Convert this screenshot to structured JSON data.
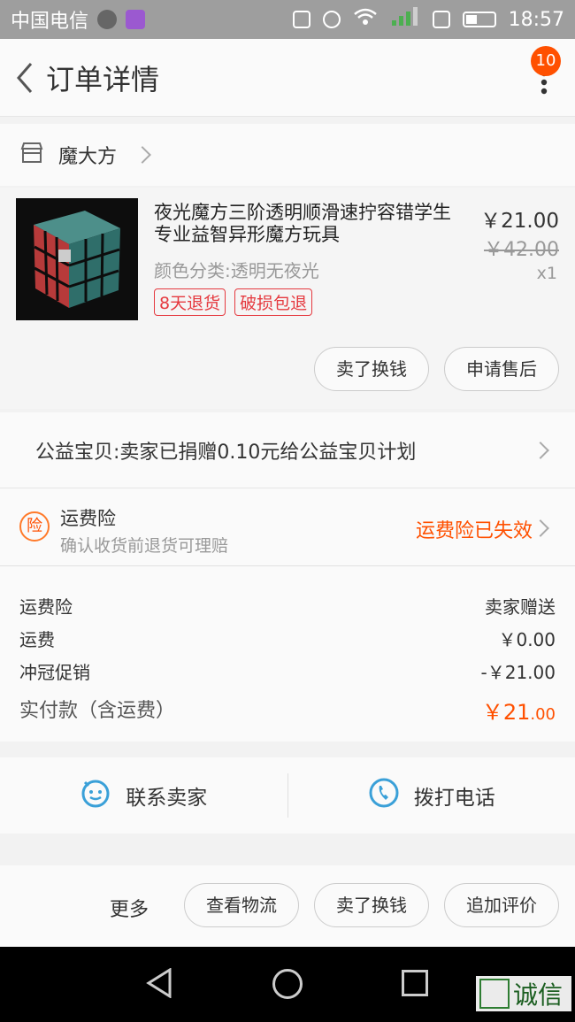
{
  "status_bar": {
    "carrier": "中国电信",
    "time": "18:57"
  },
  "header": {
    "title": "订单详情",
    "badge": "10"
  },
  "shop": {
    "name": "魔大方"
  },
  "product": {
    "title": "夜光魔方三阶透明顺滑速拧容错学生专业益智异形魔方玩具",
    "variant": "颜色分类:透明无夜光",
    "tags": [
      "8天退货",
      "破损包退"
    ],
    "price": "￥21.00",
    "original_price": "￥42.00",
    "quantity": "x1",
    "buttons": {
      "sell": "卖了换钱",
      "after_sale": "申请售后"
    }
  },
  "charity": {
    "text": "公益宝贝:卖家已捐赠0.10元给公益宝贝计划"
  },
  "insurance": {
    "icon_label": "险",
    "title": "运费险",
    "subtitle": "确认收货前退货可理赔",
    "status": "运费险已失效"
  },
  "fees": {
    "rows": [
      {
        "label": "运费险",
        "value": "卖家赠送"
      },
      {
        "label": "运费",
        "value": "￥0.00"
      },
      {
        "label": "冲冠促销",
        "value": "-￥21.00"
      }
    ],
    "total_label": "实付款（含运费）",
    "total_symbol": "￥",
    "total_integer": "21",
    "total_decimal": ".00"
  },
  "contact": {
    "seller": "联系卖家",
    "call": "拨打电话"
  },
  "actions": {
    "more": "更多",
    "logistics": "查看物流",
    "sell": "卖了换钱",
    "review": "追加评价"
  },
  "watermark": {
    "text": "诚信"
  },
  "colors": {
    "accent": "#ff5000",
    "tag": "#e5393f",
    "icon_blue": "#3aa0d8"
  }
}
